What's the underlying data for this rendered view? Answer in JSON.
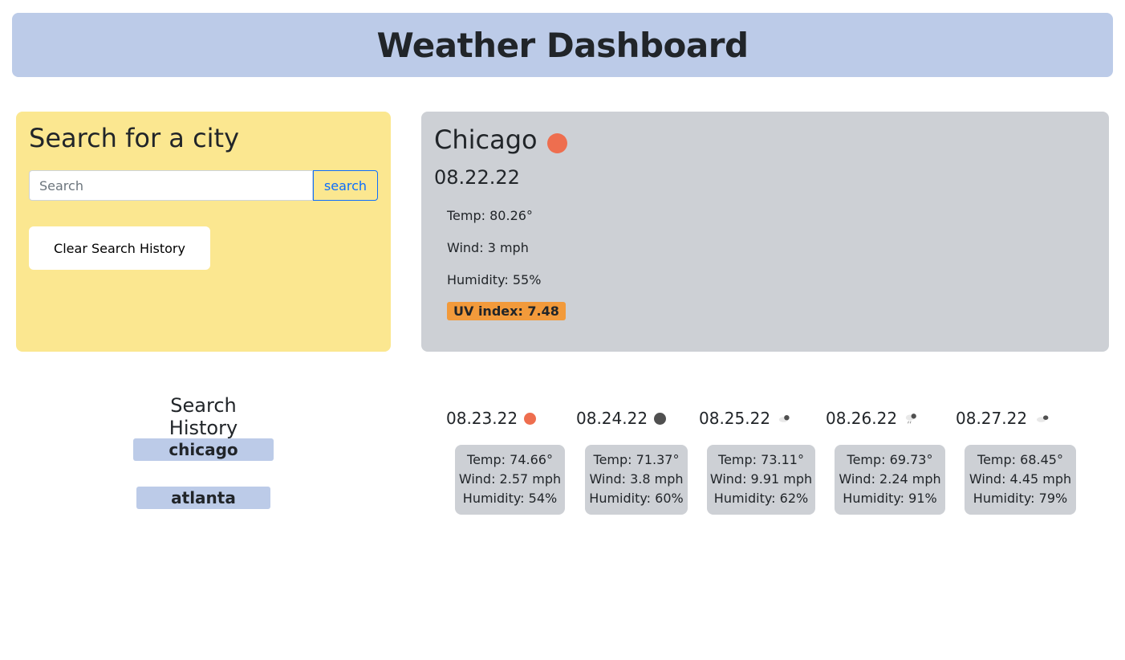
{
  "header": {
    "title": "Weather Dashboard"
  },
  "search": {
    "title": "Search for a city",
    "placeholder": "Search",
    "button_label": "search",
    "clear_label": "Clear Search History"
  },
  "current": {
    "city": "Chicago",
    "icon": "sun-icon",
    "date": "08.22.22",
    "temp": "Temp: 80.26°",
    "wind": "Wind: 3 mph",
    "humidity": "Humidity: 55%",
    "uv": "UV index: 7.48",
    "uv_color": "#f29a3b"
  },
  "history": {
    "title": "Search History",
    "items": [
      "chicago",
      "atlanta"
    ]
  },
  "forecast": [
    {
      "date": "08.23.22",
      "icon": "sun-icon",
      "temp": "Temp: 74.66°",
      "wind": "Wind: 2.57 mph",
      "humidity": "Humidity: 54%"
    },
    {
      "date": "08.24.22",
      "icon": "dark-cloud-icon",
      "temp": "Temp: 71.37°",
      "wind": "Wind: 3.8 mph",
      "humidity": "Humidity: 60%"
    },
    {
      "date": "08.25.22",
      "icon": "cloud-icon",
      "temp": "Temp: 73.11°",
      "wind": "Wind: 9.91 mph",
      "humidity": "Humidity: 62%"
    },
    {
      "date": "08.26.22",
      "icon": "rain-cloud-icon",
      "temp": "Temp: 69.73°",
      "wind": "Wind: 2.24 mph",
      "humidity": "Humidity: 91%"
    },
    {
      "date": "08.27.22",
      "icon": "cloud-icon",
      "temp": "Temp: 68.45°",
      "wind": "Wind: 4.45 mph",
      "humidity": "Humidity: 79%"
    }
  ],
  "colors": {
    "header_bg": "#bccbe8",
    "search_panel_bg": "#fbe790",
    "current_panel_bg": "#cdd0d5",
    "accent": "#0d6efd"
  }
}
